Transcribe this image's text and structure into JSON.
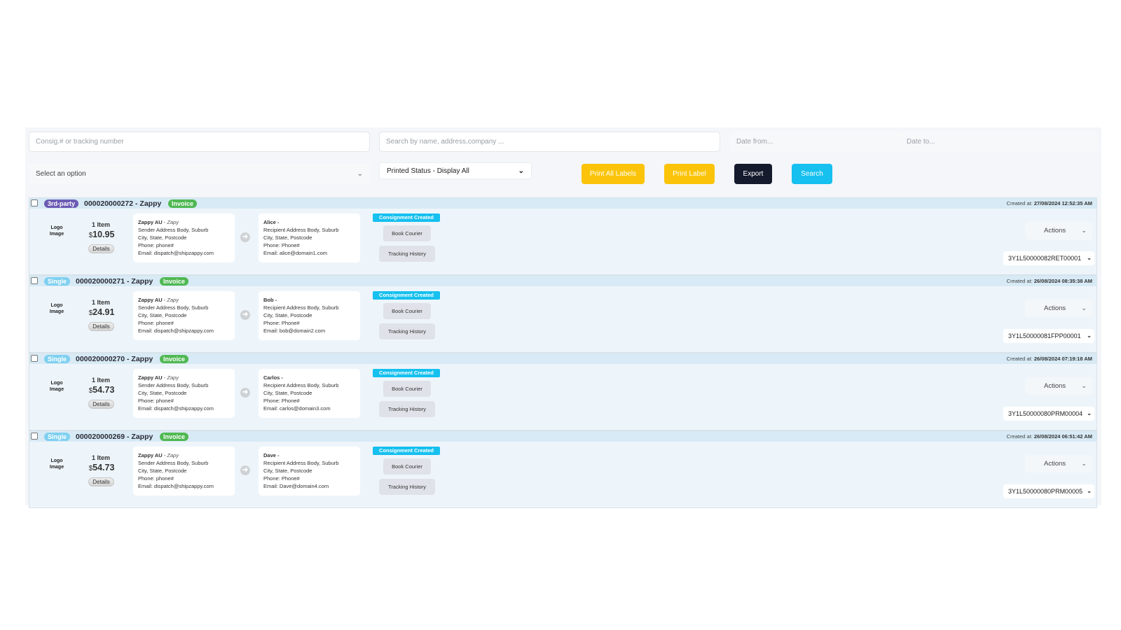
{
  "filters": {
    "consig_placeholder": "Consig.# or tracking number",
    "search_placeholder": "Search by name, address,company ...",
    "date_from_placeholder": "Date from...",
    "date_to_placeholder": "Date to...",
    "select_option": "Select an option",
    "printed_status": "Printed Status - Display All",
    "chevron": "⌄"
  },
  "toolbar": {
    "print_all_labels": "Print All Labels",
    "print_label": "Print Label",
    "export": "Export",
    "search": "Search"
  },
  "colors": {
    "yellow": "#fbc40a",
    "dark": "#151a2d",
    "blue": "#16c0ef",
    "green": "#4fb852",
    "purple": "#6b5bb3"
  },
  "rows": [
    {
      "type": "3rd-party",
      "type_style": "purple",
      "consignment": "000020000272 - Zappy",
      "invoice": "Invoice",
      "created_label": "Created at:",
      "created": "27/08/2024 12:52:35 AM",
      "logo": "Logo Image",
      "items": "1 Item",
      "currency": "$",
      "price": "10.95",
      "details": "Details",
      "sender": {
        "name": "Zappy AU",
        "company": "Zapy",
        "address": "Sender Address Body, Suburb",
        "city": "City, State, Postcode",
        "phone": "Phone: phone#",
        "email": "Email: dispatch@shipzappy.com"
      },
      "recipient": {
        "name": "Alice -",
        "address": "Recipient Address Body, Suburb",
        "city": "City, State, Postcode",
        "phone": "Phone: Phone#",
        "email": "Email: alice@domain1.com"
      },
      "status": "Consignment Created",
      "book_courier": "Book Courier",
      "tracking_history": "Tracking History",
      "actions": "Actions",
      "tracking_number": "3Y1L50000082RET00001"
    },
    {
      "type": "Single",
      "type_style": "lightblue",
      "consignment": "000020000271 - Zappy",
      "invoice": "Invoice",
      "created_label": "Created at:",
      "created": "26/08/2024 08:35:38 AM",
      "logo": "Logo Image",
      "items": "1 Item",
      "currency": "$",
      "price": "24.91",
      "details": "Details",
      "sender": {
        "name": "Zappy AU",
        "company": "Zapy",
        "address": "Sender Address Body, Suburb",
        "city": "City, State, Postcode",
        "phone": "Phone: phone#",
        "email": "Email: dispatch@shipzappy.com"
      },
      "recipient": {
        "name": "Bob -",
        "address": "Recipient Address Body, Suburb",
        "city": "City, State, Postcode",
        "phone": "Phone: Phone#",
        "email": "Email: bob@domain2.com"
      },
      "status": "Consignment Created",
      "book_courier": "Book Courier",
      "tracking_history": "Tracking History",
      "actions": "Actions",
      "tracking_number": "3Y1L50000081FPP00001"
    },
    {
      "type": "Single",
      "type_style": "lightblue",
      "consignment": "000020000270 - Zappy",
      "invoice": "Invoice",
      "created_label": "Created at:",
      "created": "26/08/2024 07:19:18 AM",
      "logo": "Logo Image",
      "items": "1 Item",
      "currency": "$",
      "price": "54.73",
      "details": "Details",
      "sender": {
        "name": "Zappy AU",
        "company": "Zapy",
        "address": "Sender Address Body, Suburb",
        "city": "City, State, Postcode",
        "phone": "Phone: phone#",
        "email": "Email: dispatch@shipzappy.com"
      },
      "recipient": {
        "name": "Carlos -",
        "address": "Recipient Address Body, Suburb",
        "city": "City, State, Postcode",
        "phone": "Phone: Phone#",
        "email": "Email: carlos@domain3.com"
      },
      "status": "Consignment Created",
      "book_courier": "Book Courier",
      "tracking_history": "Tracking History",
      "actions": "Actions",
      "tracking_number": "3Y1L50000080PRM00004"
    },
    {
      "type": "Single",
      "type_style": "lightblue",
      "consignment": "000020000269 - Zappy",
      "invoice": "Invoice",
      "created_label": "Created at:",
      "created": "26/08/2024 06:51:42 AM",
      "logo": "Logo Image",
      "items": "1 Item",
      "currency": "$",
      "price": "54.73",
      "details": "Details",
      "sender": {
        "name": "Zappy AU",
        "company": "Zapy",
        "address": "Sender Address Body, Suburb",
        "city": "City, State, Postcode",
        "phone": "Phone: phone#",
        "email": "Email: dispatch@shipzappy.com"
      },
      "recipient": {
        "name": "Dave -",
        "address": "Recipient Address Body, Suburb",
        "city": "City, State, Postcode",
        "phone": "Phone: Phone#",
        "email": "Email: Dave@domain4.com"
      },
      "status": "Consignment Created",
      "book_courier": "Book Courier",
      "tracking_history": "Tracking History",
      "actions": "Actions",
      "tracking_number": "3Y1L50000080PRM00005"
    }
  ]
}
